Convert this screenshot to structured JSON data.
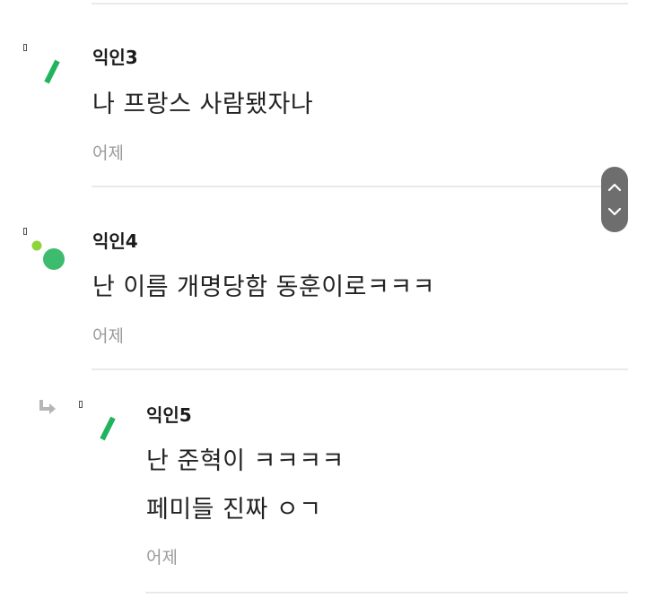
{
  "comments": [
    {
      "author": "익인3",
      "lines": [
        "나 프랑스 사람됐자나"
      ],
      "time": "어제"
    },
    {
      "author": "익인4",
      "lines": [
        "난 이름 개명당함 동훈이로ㅋㅋㅋ"
      ],
      "time": "어제"
    },
    {
      "author": "익인5",
      "lines": [
        "난 준혁이 ㅋㅋㅋㅋ",
        "페미들 진짜 ㅇㄱ"
      ],
      "time": "어제",
      "is_reply": true
    }
  ],
  "scroll_controls": {
    "up_icon": "chevron-up-icon",
    "down_icon": "chevron-down-icon"
  },
  "colors": {
    "avatar_green": "#22b35e",
    "avatar_circle": "#3dbb6e",
    "avatar_dot": "#8bd43a",
    "divider": "#e9e9e9",
    "time_gray": "#9a9a9a"
  }
}
